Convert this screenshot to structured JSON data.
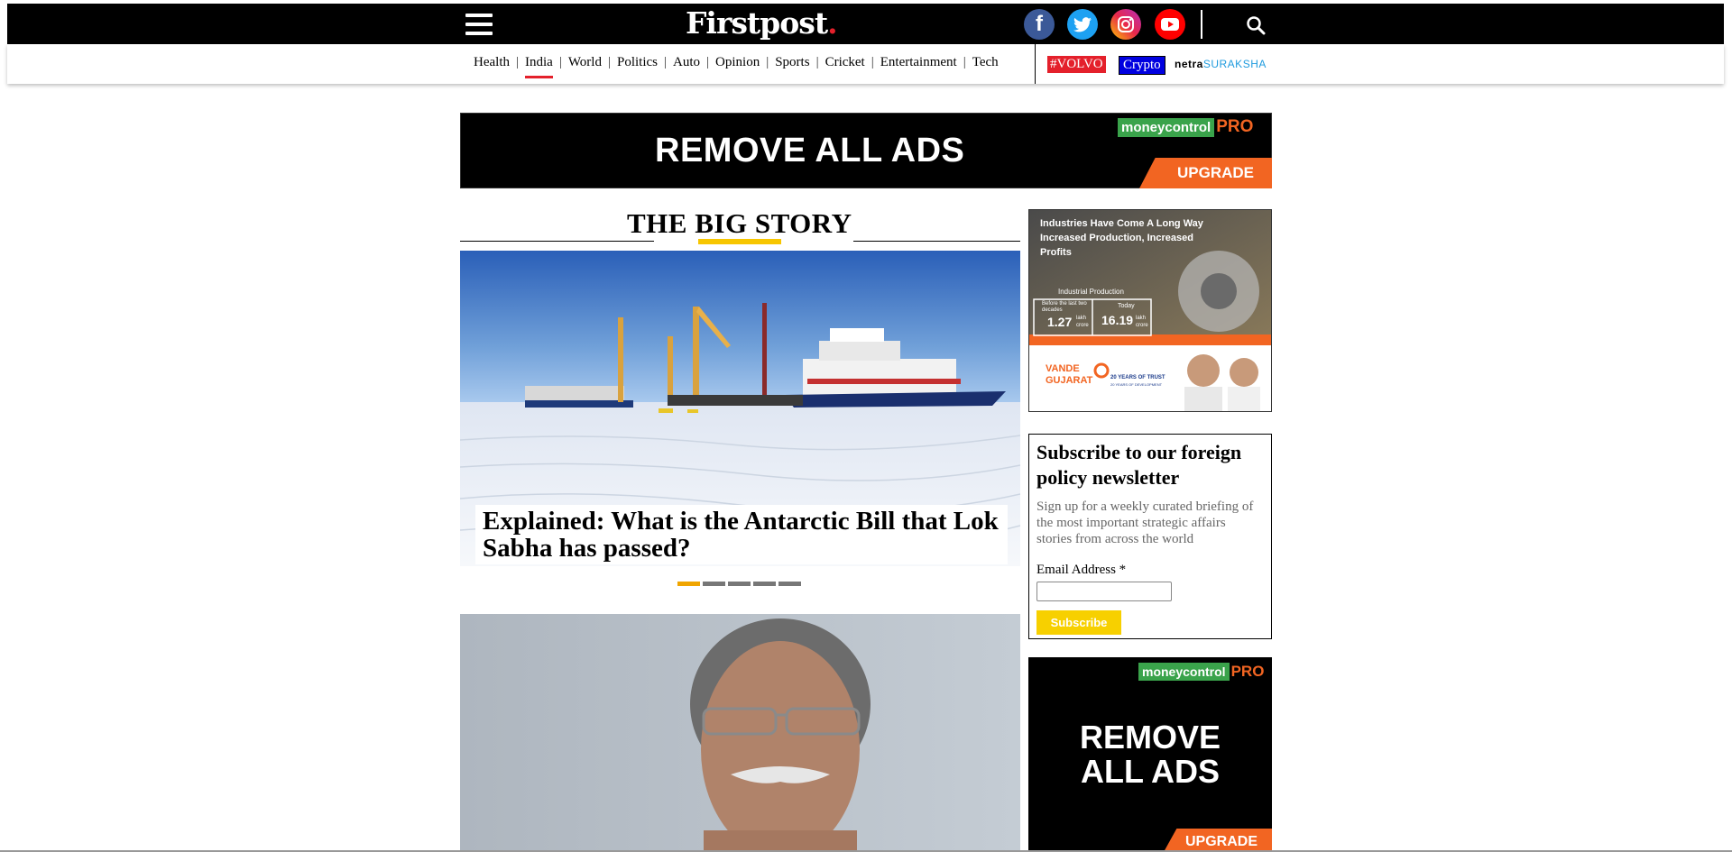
{
  "header": {
    "logo_text": "Firstpost",
    "logo_dot": ".",
    "social": [
      "facebook-icon",
      "twitter-icon",
      "instagram-icon",
      "youtube-icon"
    ]
  },
  "nav": {
    "items": [
      "Health",
      "India",
      "World",
      "Politics",
      "Auto",
      "Opinion",
      "Sports",
      "Cricket",
      "Entertainment",
      "Tech"
    ],
    "active": "India",
    "separator": "|",
    "tags": {
      "volvo": "#VOLVO",
      "crypto": "Crypto",
      "netra_a": "netra",
      "netra_b": "SURAKSHA"
    }
  },
  "banner_ad": {
    "text": "REMOVE ALL ADS",
    "brand_a": "money",
    "brand_b": "control",
    "pro": "PRO",
    "upgrade": "UPGRADE"
  },
  "big_story": {
    "title_a": "THE",
    "title_b": "BIG STORY",
    "headline": "Explained: What is the Antarctic Bill that Lok Sabha has passed?",
    "slide_count": 5,
    "active_slide": 1
  },
  "side_ad": {
    "headline": "Industries Have Come A Long Way Increased Production, Increased Profits",
    "label": "Industrial Production",
    "before_label": "Before the last two decades",
    "before_value": "1.27",
    "before_unit": "lakh crore",
    "today_label": "Today",
    "today_value": "16.19",
    "today_unit": "lakh crore",
    "campaign_a": "VANDE",
    "campaign_b": "GUJARAT",
    "campaign_tag": "20 YEARS OF TRUST",
    "campaign_sub": "20 YEARS OF DEVELOPMENT"
  },
  "newsletter": {
    "title": "Subscribe to our foreign policy newsletter",
    "description": "Sign up for a weekly curated briefing of the most important strategic affairs stories from across the world",
    "email_label": "Email Address *",
    "email_value": "",
    "button": "Subscribe"
  },
  "side_ad2": {
    "line1": "REMOVE",
    "line2": "ALL ADS",
    "brand_a": "money",
    "brand_b": "control",
    "pro": "PRO",
    "upgrade": "UPGRADE"
  },
  "colors": {
    "accent_red": "#e4202b",
    "story_yellow": "#f7c600",
    "moneycontrol_green": "#3aa34b",
    "upgrade_orange": "#f26522"
  }
}
